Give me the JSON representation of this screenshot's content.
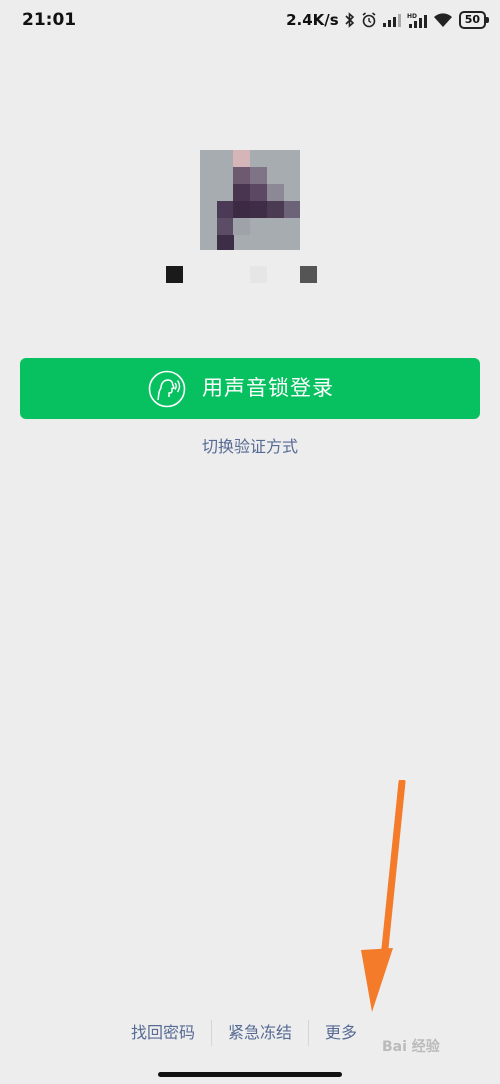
{
  "status_bar": {
    "time": "21:01",
    "network_speed": "2.4K/s",
    "battery_level": "50",
    "icons": [
      "bluetooth-icon",
      "alarm-icon",
      "signal-icon",
      "hd-signal-icon",
      "wifi-icon",
      "battery-icon"
    ]
  },
  "login": {
    "voice_button_label": "用声音锁登录",
    "voice_icon": "voice-face-icon",
    "switch_method_label": "切换验证方式"
  },
  "bottom_links": {
    "recover_password": "找回密码",
    "emergency_freeze": "紧急冻结",
    "more": "更多"
  },
  "watermark": "Bai 经验",
  "colors": {
    "background": "#ededed",
    "primary_green": "#07c160",
    "link_blue": "#576b95",
    "arrow_orange": "#f47b2a"
  }
}
